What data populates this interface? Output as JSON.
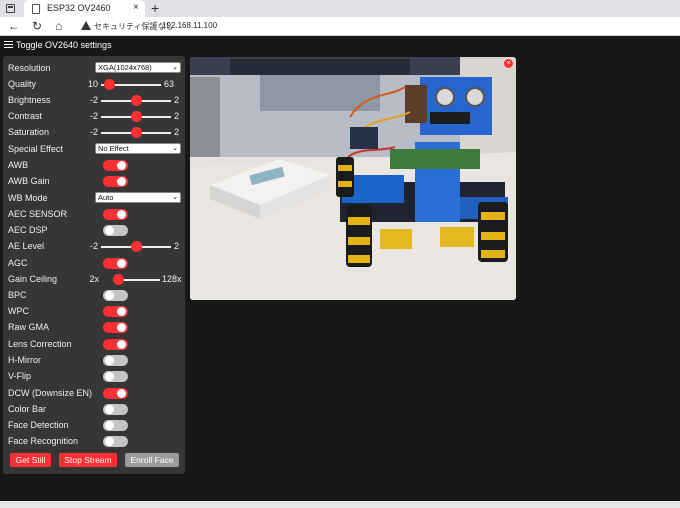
{
  "browser": {
    "tab_title": "ESP32 OV2460",
    "tab_close": "×",
    "new_tab": "+",
    "security_warning": "セキュリティ保護なし",
    "url": "192.168.11.100"
  },
  "header": {
    "title": "Toggle OV2640 settings"
  },
  "settings": {
    "resolution": {
      "label": "Resolution",
      "value": "XGA(1024x768)"
    },
    "quality": {
      "label": "Quality",
      "min": "10",
      "max": "63",
      "level": 0.06
    },
    "brightness": {
      "label": "Brightness",
      "min": "-2",
      "max": "2",
      "level": 0.5
    },
    "contrast": {
      "label": "Contrast",
      "min": "-2",
      "max": "2",
      "level": 0.5
    },
    "saturation": {
      "label": "Saturation",
      "min": "-2",
      "max": "2",
      "level": 0.5
    },
    "special_effect": {
      "label": "Special Effect",
      "value": "No Effect"
    },
    "awb": {
      "label": "AWB",
      "on": true
    },
    "awb_gain": {
      "label": "AWB Gain",
      "on": true
    },
    "wb_mode": {
      "label": "WB Mode",
      "value": "Auto"
    },
    "aec_sensor": {
      "label": "AEC SENSOR",
      "on": true
    },
    "aec_dsp": {
      "label": "AEC DSP",
      "on": false
    },
    "ae_level": {
      "label": "AE Level",
      "min": "-2",
      "max": "2",
      "level": 0.5
    },
    "agc": {
      "label": "AGC",
      "on": true
    },
    "gain_ceiling": {
      "label": "Gain Ceiling",
      "min": "2x",
      "max": "128x",
      "level": 0.0
    },
    "bpc": {
      "label": "BPC",
      "on": false
    },
    "wpc": {
      "label": "WPC",
      "on": true
    },
    "raw_gma": {
      "label": "Raw GMA",
      "on": true
    },
    "lens_correction": {
      "label": "Lens Correction",
      "on": true
    },
    "h_mirror": {
      "label": "H-Mirror",
      "on": false
    },
    "v_flip": {
      "label": "V-Flip",
      "on": false
    },
    "dcw": {
      "label": "DCW (Downsize EN)",
      "on": true
    },
    "color_bar": {
      "label": "Color Bar",
      "on": false
    },
    "face_detection": {
      "label": "Face Detection",
      "on": false
    },
    "face_recognition": {
      "label": "Face Recognition",
      "on": false
    }
  },
  "buttons": {
    "get_still": {
      "label": "Get Still",
      "color": "#ff3034"
    },
    "stop_stream": {
      "label": "Stop Stream",
      "color": "#ff3034"
    },
    "enroll_face": {
      "label": "Enroll Face",
      "color": "#9c9c9c"
    }
  },
  "stream": {
    "close_label": "×"
  },
  "colors": {
    "accent": "#ff3034",
    "panel": "#363636",
    "background": "#181818"
  }
}
